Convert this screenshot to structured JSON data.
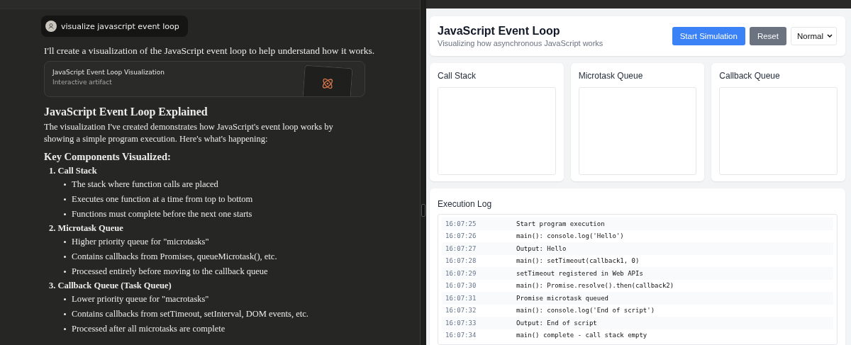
{
  "chat": {
    "prompt": "visualize javascript event loop",
    "reply": "I'll create a visualization of the JavaScript event loop to help understand how it works.",
    "artifact": {
      "title": "JavaScript Event Loop Visualization",
      "subtitle": "Interactive artifact"
    },
    "heading": "JavaScript Event Loop Explained",
    "intro": "The visualization I've created demonstrates how JavaScript's event loop works by showing a simple program execution. Here's what's happening:",
    "subheading": "Key Components Visualized:",
    "sections": [
      {
        "number": "1.",
        "title": "Call Stack",
        "bullets": [
          "The stack where function calls are placed",
          "Executes one function at a time from top to bottom",
          "Functions must complete before the next one starts"
        ]
      },
      {
        "number": "2.",
        "title": "Microtask Queue",
        "bullets": [
          "Higher priority queue for \"microtasks\"",
          "Contains callbacks from Promises, queueMicrotask(), etc.",
          "Processed entirely before moving to the callback queue"
        ]
      },
      {
        "number": "3.",
        "title": "Callback Queue (Task Queue)",
        "bullets": [
          "Lower priority queue for \"macrotasks\"",
          "Contains callbacks from setTimeout, setInterval, DOM events, etc.",
          "Processed after all microtasks are complete"
        ]
      }
    ]
  },
  "app": {
    "title": "JavaScript Event Loop",
    "subtitle": "Visualizing how asynchronous JavaScript works",
    "buttons": [
      {
        "label": "Start Simulation",
        "kind": "primary"
      },
      {
        "label": "Reset",
        "kind": "secondary"
      }
    ],
    "speed": "Normal",
    "queues": [
      {
        "title": "Call Stack"
      },
      {
        "title": "Microtask Queue"
      },
      {
        "title": "Callback Queue"
      }
    ],
    "log": {
      "title": "Execution Log",
      "entries": [
        {
          "time": "16:07:25",
          "message": "Start program execution"
        },
        {
          "time": "16:07:26",
          "message": "main(): console.log('Hello')"
        },
        {
          "time": "16:07:27",
          "message": "Output: Hello"
        },
        {
          "time": "16:07:28",
          "message": "main(): setTimeout(callback1, 0)"
        },
        {
          "time": "16:07:29",
          "message": "setTimeout registered in Web APIs"
        },
        {
          "time": "16:07:30",
          "message": "main(): Promise.resolve().then(callback2)"
        },
        {
          "time": "16:07:31",
          "message": "Promise microtask queued"
        },
        {
          "time": "16:07:32",
          "message": "main(): console.log('End of script')"
        },
        {
          "time": "16:07:33",
          "message": "Output: End of script"
        },
        {
          "time": "16:07:34",
          "message": "main() complete - call stack empty"
        }
      ]
    }
  }
}
